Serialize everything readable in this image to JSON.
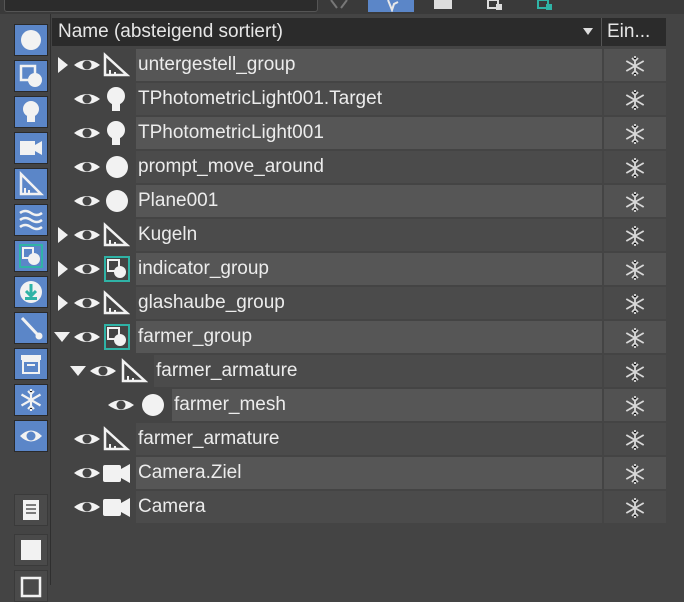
{
  "header": {
    "name_col": "Name (absteigend sortiert)",
    "freeze_col": "Ein..."
  },
  "rows": [
    {
      "label": "untergestell_group"
    },
    {
      "label": "TPhotometricLight001.Target"
    },
    {
      "label": "TPhotometricLight001"
    },
    {
      "label": "prompt_move_around"
    },
    {
      "label": "Plane001"
    },
    {
      "label": "Kugeln"
    },
    {
      "label": "indicator_group"
    },
    {
      "label": "glashaube_group"
    },
    {
      "label": "farmer_group"
    },
    {
      "label": "farmer_armature"
    },
    {
      "label": "farmer_mesh"
    },
    {
      "label": "farmer_armature"
    },
    {
      "label": "Camera.Ziel"
    },
    {
      "label": "Camera"
    }
  ],
  "colors": {
    "accent": "#5b86c8",
    "teal": "#2fb3a6",
    "panel": "#444444"
  },
  "icons": {
    "left_toolbar": [
      "sphere-icon",
      "geometry-icon",
      "light-bulb-icon",
      "camera-icon",
      "helper-icon",
      "spacewarp-icon",
      "group-icon",
      "xref-icon",
      "bone-icon",
      "container-icon",
      "freeze-icon",
      "eye-icon",
      "list-icon",
      "square-icon",
      "layer-icon"
    ]
  }
}
